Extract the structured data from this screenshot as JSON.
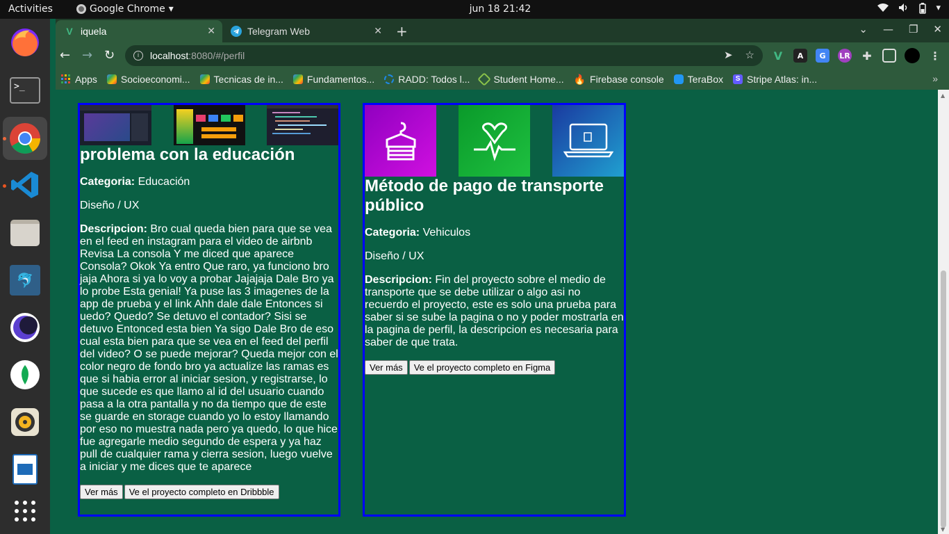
{
  "topbar": {
    "activities": "Activities",
    "app_name": "Google Chrome",
    "clock": "jun 18  21:42"
  },
  "dock": {
    "items": [
      "firefox-icon",
      "terminal-icon",
      "chrome-icon",
      "vscode-icon",
      "files-icon",
      "mysql-workbench-icon",
      "eclipse-icon",
      "mongodb-compass-icon",
      "rhythmbox-icon",
      "libreoffice-impress-icon",
      "show-apps-icon"
    ]
  },
  "tabs": [
    {
      "title": "iquela",
      "favicon": "V",
      "active": true
    },
    {
      "title": "Telegram Web",
      "favicon": "telegram",
      "active": false
    }
  ],
  "omnibox": {
    "host": "localhost",
    "path": ":8080/#/perfil"
  },
  "bookmarks": [
    {
      "label": "Apps",
      "color": "#e8453c"
    },
    {
      "label": "Socioeconomi...",
      "color": "#7c4dff"
    },
    {
      "label": "Tecnicas de in...",
      "color": "#7c4dff"
    },
    {
      "label": "Fundamentos...",
      "color": "#7c4dff"
    },
    {
      "label": "RADD: Todos l...",
      "color": "#1e88e5"
    },
    {
      "label": "Student Home...",
      "color": "#8bc34a"
    },
    {
      "label": "Firebase console",
      "color": "#ffa000"
    },
    {
      "label": "TeraBox",
      "color": "#2196f3"
    },
    {
      "label": "Stripe Atlas: in...",
      "color": "#635bff"
    }
  ],
  "cards": [
    {
      "title": "problema con la educación",
      "categoria_label": "Categoria:",
      "categoria": "Educación",
      "tipo": "Diseño / UX",
      "descripcion_label": "Descripcion:",
      "descripcion": "Bro cual queda bien para que se vea en el feed en instagram para el video de airbnb Revisa La consola Y me diced que aparece Consola? Okok Ya entro Que raro, ya funciono bro jaja Ahora si ya lo voy a probar Jajajaja Dale Bro ya lo probe Esta genial! Ya puse las 3 imagenes de la app de prueba y el link Ahh dale dale Entonces si uedo? Quedo? Se detuvo el contador? Sisi se detuvo Entonced esta bien Ya sigo Dale Bro de eso cual esta bien para que se vea en el feed del perfil del video? O se puede mejorar? Queda mejor con el color negro de fondo bro ya actualize las ramas es que si habia error al iniciar sesion, y registrarse, lo que sucede es que llamo al id del usuario cuando pasa a la otra pantalla y no da tiempo que de este se guarde en storage cuando yo lo estoy llamando por eso no muestra nada pero ya quedo, lo que hice fue agregarle medio segundo de espera y ya haz pull de cualquier rama y cierra sesion, luego vuelve a iniciar y me dices que te aparece",
      "btn_more": "Ver más",
      "btn_link": "Ve el proyecto completo en Dribbble"
    },
    {
      "title": "Método de pago de transporte público",
      "categoria_label": "Categoria:",
      "categoria": "Vehiculos",
      "tipo": "Diseño / UX",
      "descripcion_label": "Descripcion:",
      "descripcion": "Fin del proyecto sobre el medio de transporte que se debe utilizar o algo asi no recuerdo el proyecto, este es solo una prueba para saber si se sube la pagina o no y poder mostrarla en la pagina de perfil, la descripcion es necesaria para saber de que trata.",
      "btn_more": "Ver más",
      "btn_link": "Ve el proyecto completo en Figma"
    }
  ]
}
